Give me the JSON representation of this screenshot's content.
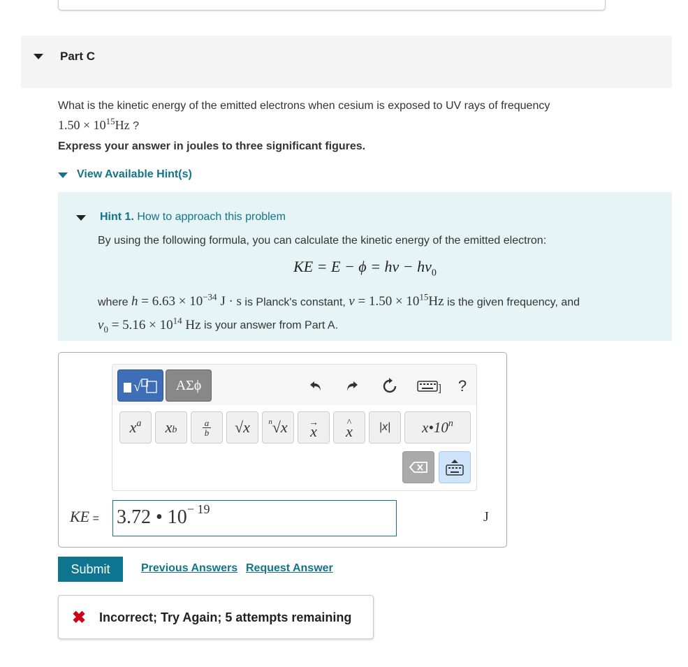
{
  "part": {
    "title": "Part C"
  },
  "question": {
    "text": "What is the kinetic energy of the emitted electrons when cesium is exposed to UV rays of frequency",
    "freq_mantissa": "1.50 × 10",
    "freq_exp": "15",
    "freq_unit": "Hz",
    "qmark": " ?"
  },
  "instruction": "Express your answer in joules to three significant figures.",
  "hints": {
    "toggle_label": "View Available Hint(s)",
    "hint1": {
      "label": "Hint 1.",
      "title": "How to approach this problem",
      "intro": "By using the following formula, you can calculate the kinetic energy of the emitted electron:",
      "formula": "KE = E − ϕ = hν − hν",
      "formula_sub": "0",
      "where_prefix": "where",
      "h_expr": "h = 6.63 × 10",
      "h_exp": "−34",
      "h_unit": "J · s",
      "h_desc": "is Planck's constant,",
      "nu_expr": "ν = 1.50 × 10",
      "nu_exp": "15",
      "nu_unit": "Hz",
      "nu_desc": "is the given frequency, and",
      "nu0_sym": "ν",
      "nu0_sub": "0",
      "nu0_expr": "= 5.16 × 10",
      "nu0_exp": "14",
      "nu0_unit": "Hz",
      "nu0_desc": "is your answer from Part A."
    }
  },
  "editor": {
    "tab_templates": "templates",
    "tab_greek": "ΑΣϕ",
    "buttons": {
      "power_base": "x",
      "power_exp": "a",
      "sub_base": "x",
      "sub_idx": "b",
      "frac_num": "a",
      "frac_den": "b",
      "sqrt": "√x",
      "nthroot_idx": "n",
      "nthroot": "√x",
      "vector": "x",
      "hat": "x",
      "abs": "|x|",
      "sci": "x•10",
      "sci_exp": "n"
    },
    "help": "?"
  },
  "answer": {
    "label": "KE",
    "eq": " =",
    "value": "3.72 • 10",
    "exponent": "− 19",
    "unit": "J"
  },
  "actions": {
    "submit": "Submit",
    "previous": "Previous Answers",
    "request": "Request Answer"
  },
  "feedback": {
    "text": "Incorrect; Try Again; 5 attempts remaining"
  }
}
